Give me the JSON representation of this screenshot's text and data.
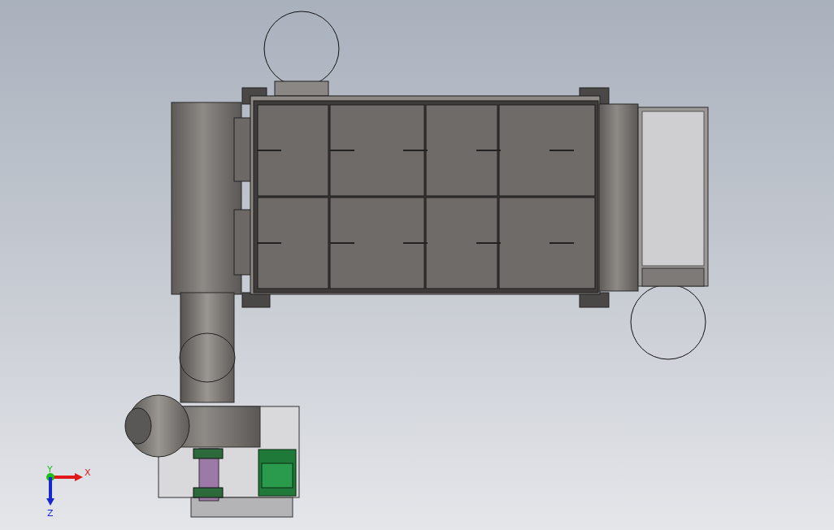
{
  "view": {
    "axes": [
      {
        "label": "X",
        "kind": "right",
        "color": "#e01818"
      },
      {
        "label": "Y",
        "kind": "toward",
        "color": "#18c018"
      },
      {
        "label": "Z",
        "kind": "down",
        "color": "#1828d0"
      }
    ]
  }
}
